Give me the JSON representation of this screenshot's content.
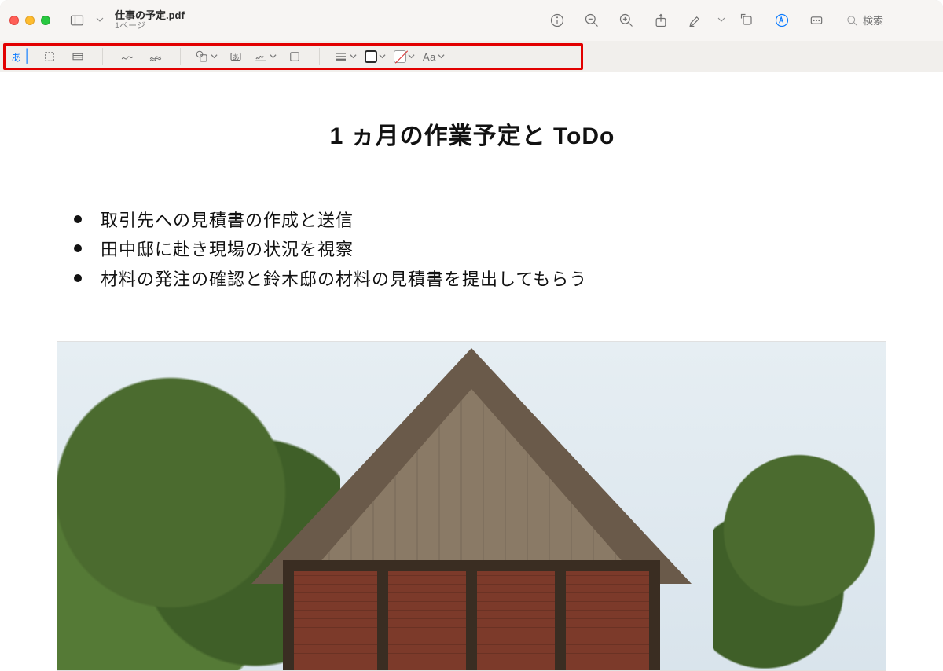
{
  "window": {
    "filename": "仕事の予定.pdf",
    "subtitle": "1ページ"
  },
  "search": {
    "placeholder": "検索"
  },
  "markup": {
    "text_tool_glyph": "あ",
    "text_box_glyph": "あ",
    "font_label": "Aa"
  },
  "document": {
    "title": "1 ヵ月の作業予定と ToDo",
    "items": [
      "取引先への見積書の作成と送信",
      "田中邸に赴き現場の状況を視察",
      "材料の発注の確認と鈴木邸の材料の見積書を提出してもらう"
    ]
  }
}
